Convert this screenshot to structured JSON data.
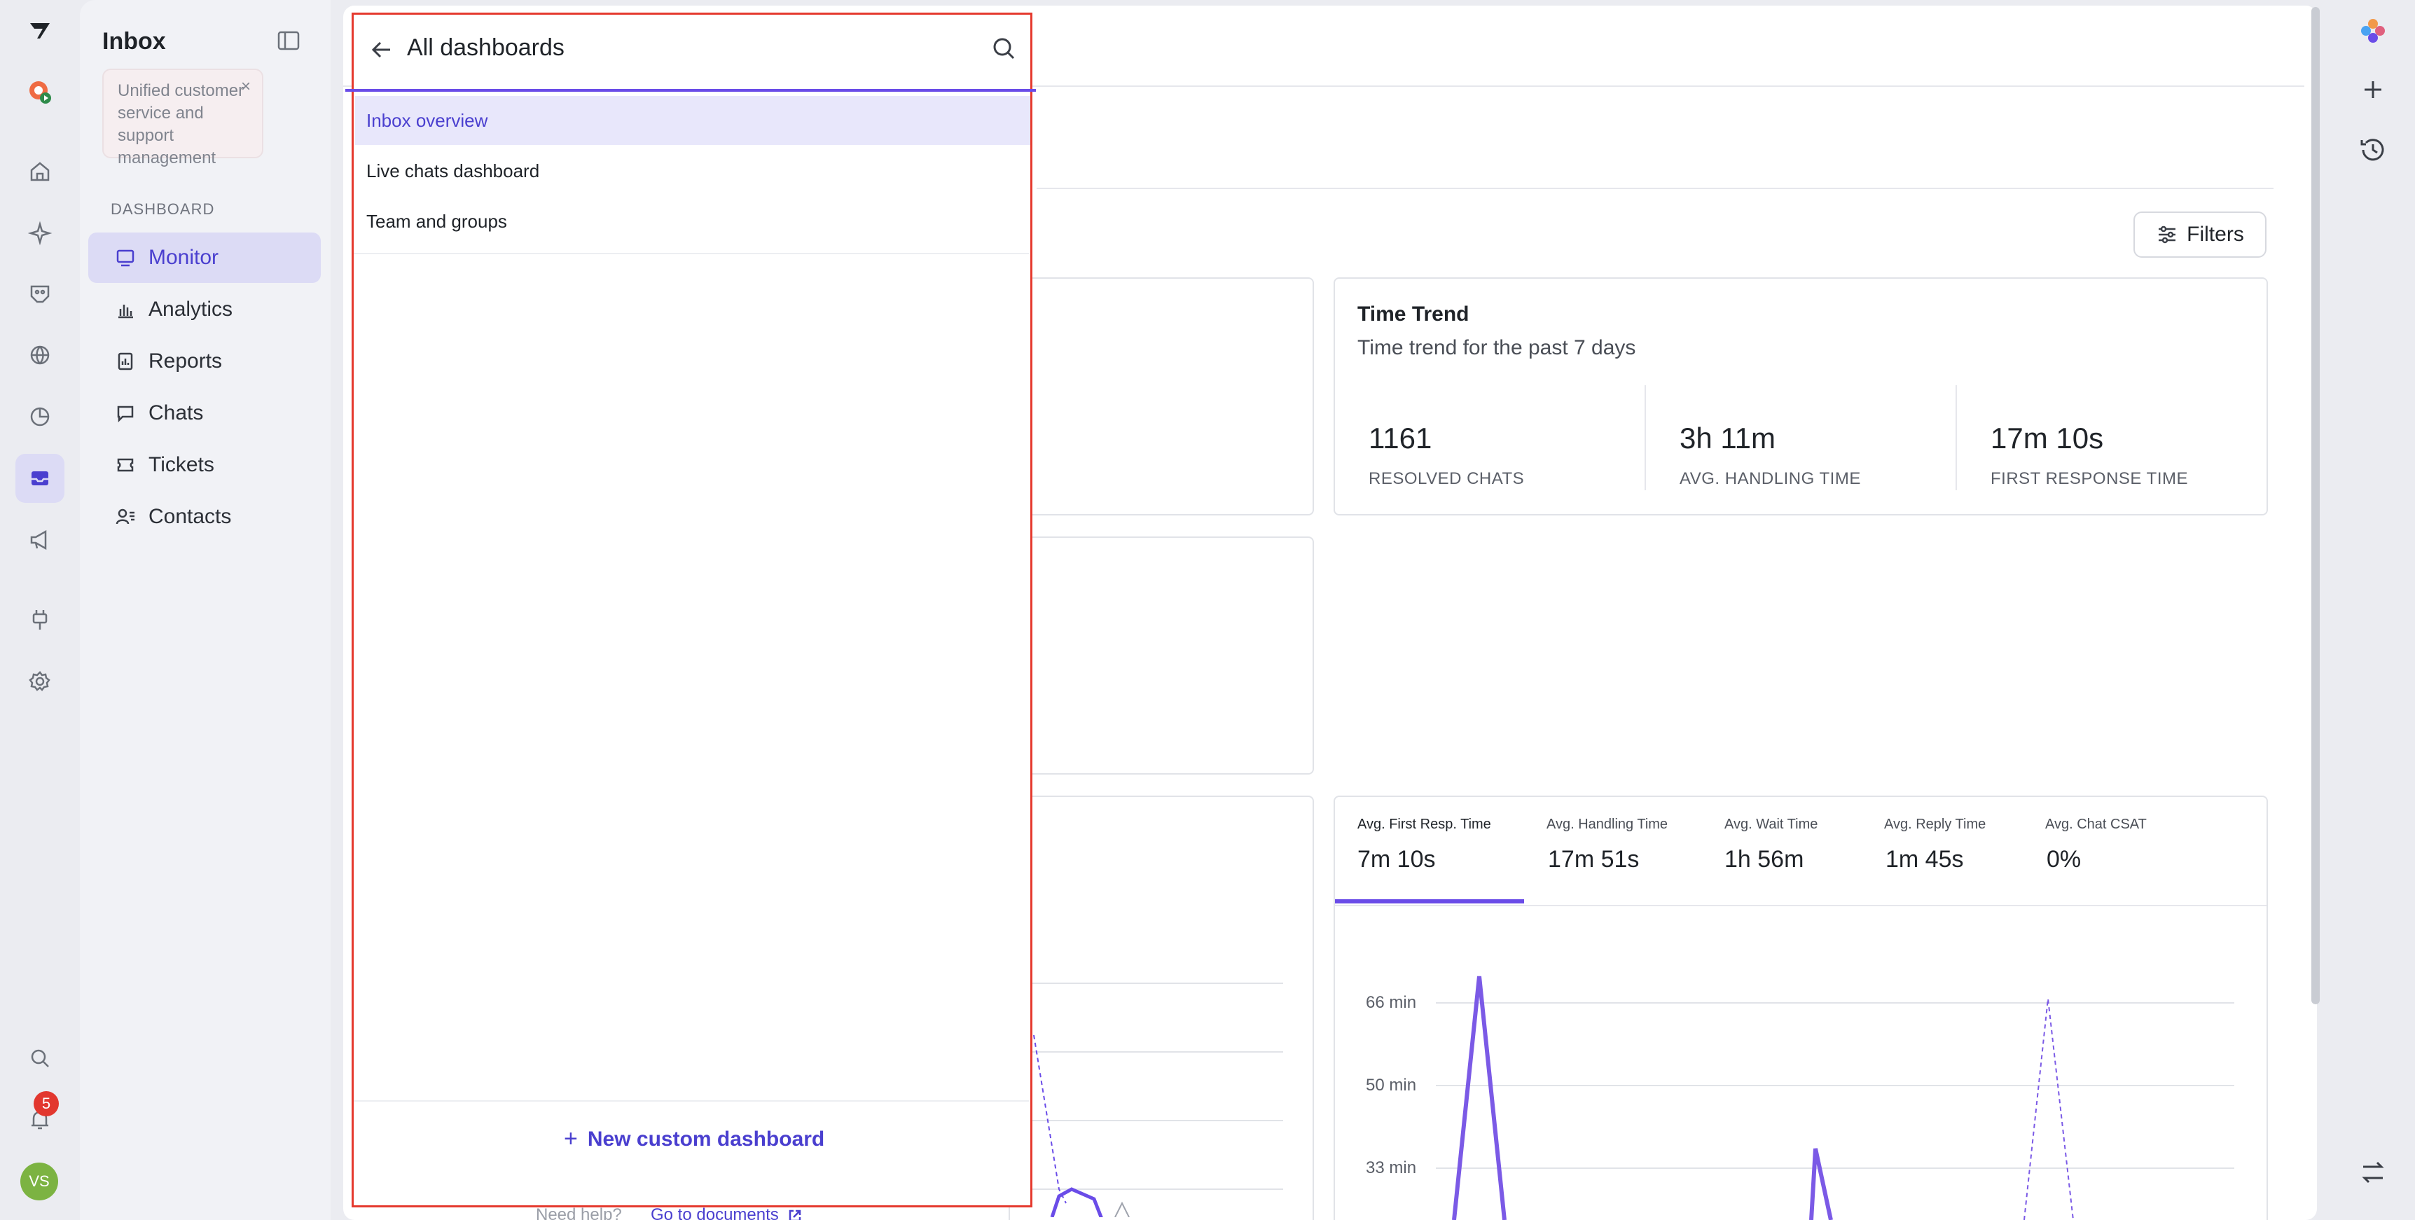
{
  "rail": {
    "notification_count": "5",
    "avatar_initials": "VS"
  },
  "sidebar": {
    "title": "Inbox",
    "promo_text": "Unified customer service and support management",
    "promo_close": "×",
    "section_label": "DASHBOARD",
    "items": [
      {
        "label": "Monitor",
        "icon": "monitor-icon"
      },
      {
        "label": "Analytics",
        "icon": "bar-chart-icon"
      },
      {
        "label": "Reports",
        "icon": "report-icon"
      },
      {
        "label": "Chats",
        "icon": "chat-icon"
      },
      {
        "label": "Tickets",
        "icon": "ticket-icon"
      },
      {
        "label": "Contacts",
        "icon": "contacts-icon"
      }
    ]
  },
  "main": {
    "filters_label": "Filters",
    "time_trend": {
      "title": "Time Trend",
      "subtitle": "Time trend for the past 7 days",
      "metrics": [
        {
          "value": "1161",
          "label": "RESOLVED CHATS"
        },
        {
          "value": "3h 11m",
          "label": "AVG. HANDLING TIME"
        },
        {
          "value": "17m 10s",
          "label": "FIRST RESPONSE TIME"
        }
      ]
    },
    "tabs": [
      {
        "label": "Avg. First Resp. Time",
        "value": "7m 10s"
      },
      {
        "label": "Avg. Handling Time",
        "value": "17m 51s"
      },
      {
        "label": "Avg. Wait Time",
        "value": "1h 56m"
      },
      {
        "label": "Avg. Reply Time",
        "value": "1m 45s"
      },
      {
        "label": "Avg. Chat CSAT",
        "value": "0%"
      }
    ],
    "y_axis_ticks": [
      "66 min",
      "50 min",
      "33 min"
    ]
  },
  "panel": {
    "title": "All dashboards",
    "items": [
      "Inbox overview",
      "Live chats dashboard",
      "Team and groups"
    ],
    "new_dashboard_label": "New custom dashboard",
    "new_dashboard_plus": "+",
    "help_text": "Need help?",
    "docs_link": "Go to documents"
  },
  "colors": {
    "accent": "#6a4ce8",
    "highlight_border": "#e53a2e",
    "active_bg": "#dcdbf5"
  }
}
